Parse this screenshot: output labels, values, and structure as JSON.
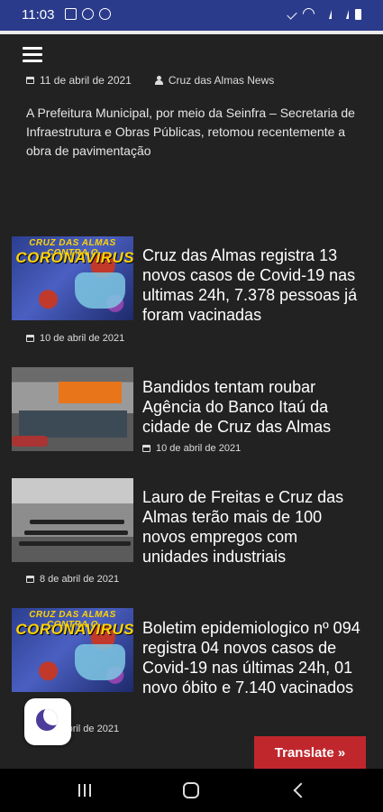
{
  "status_bar": {
    "time": "11:03"
  },
  "header": {
    "menu_icon": "hamburger-icon"
  },
  "featured": {
    "date": "11 de abril de 2021",
    "author": "Cruz das Almas News",
    "excerpt": "A Prefeitura Municipal, por meio da Seinfra – Secretaria de Infraestrutura e Obras Públicas, retomou recentemente a obra de pavimentação"
  },
  "thumbs": {
    "covid_banner_top": "CRUZ DAS ALMAS CONTRA O",
    "covid_banner_main": "CORONAVIRUS"
  },
  "articles": [
    {
      "title": "Cruz das Almas registra 13 novos casos de Covid-19 nas ultimas 24h, 7.378 pessoas já foram vacinadas",
      "date": "10 de abril de 2021"
    },
    {
      "title": "Bandidos tentam roubar Agência do Banco Itaú da cidade de Cruz das Almas",
      "date": "10 de abril de 2021"
    },
    {
      "title": "Lauro de Freitas e Cruz das Almas terão mais de 100 novos empregos com unidades industriais",
      "date": "8 de abril de 2021"
    },
    {
      "title": "Boletim epidemiologico nº 094 registra 04 novos casos de Covid-19 nas últimas 24h, 01 novo óbito e 7.140 vacinados",
      "date": "9 de abril de 2021"
    }
  ],
  "translate_label": "Translate »",
  "colors": {
    "status_bar": "#2b3b8c",
    "background": "#222222",
    "translate": "#c0272d"
  }
}
